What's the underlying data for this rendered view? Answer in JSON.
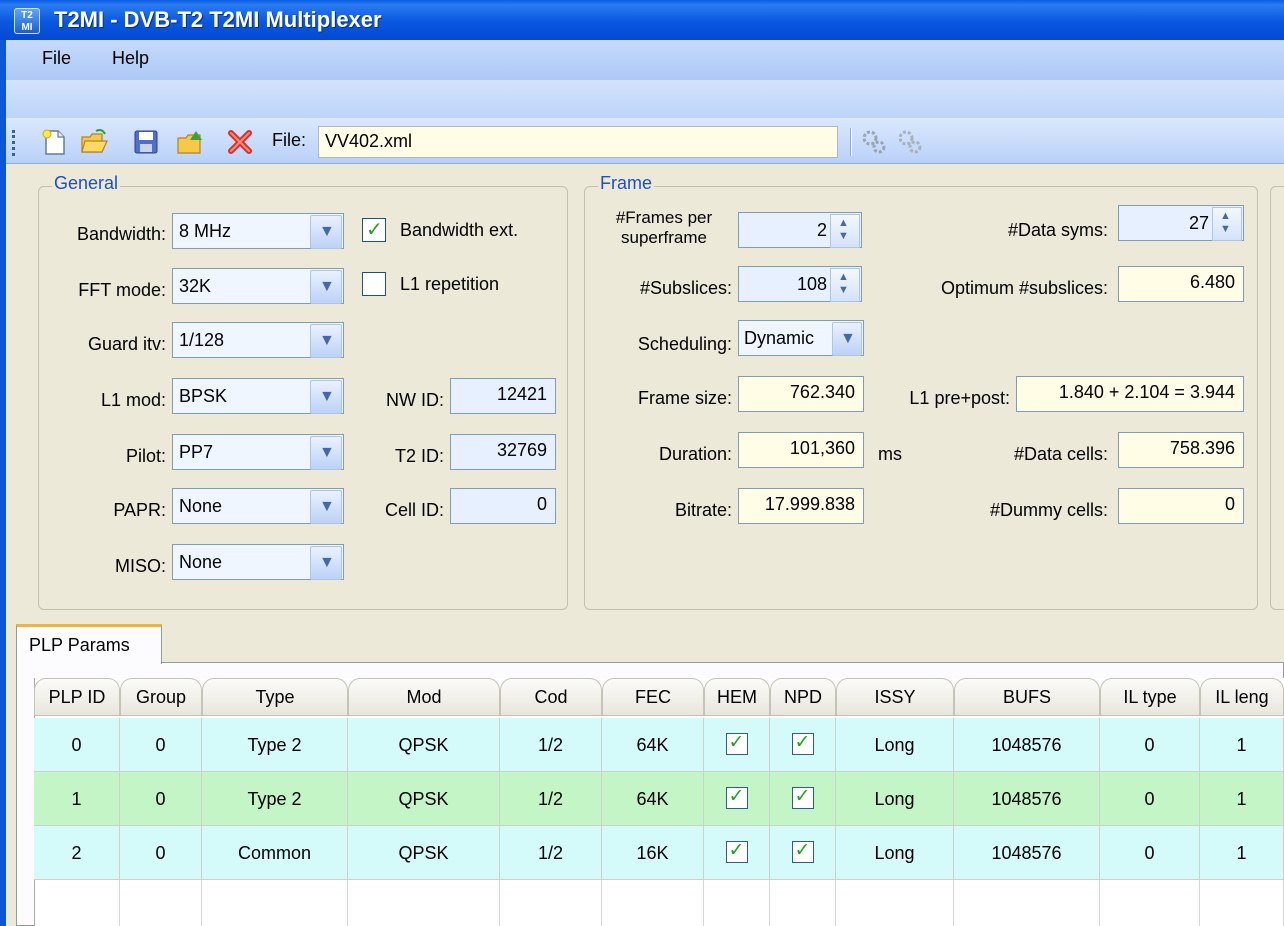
{
  "window": {
    "title": "T2MI - DVB-T2 T2MI Multiplexer",
    "icon_text": "T2\nMI"
  },
  "menu": {
    "file": "File",
    "help": "Help"
  },
  "toolbar": {
    "file_label": "File:",
    "file_value": "VV402.xml"
  },
  "general": {
    "title": "General",
    "bandwidth_label": "Bandwidth:",
    "bandwidth_value": "8 MHz",
    "bandwidth_ext_label": "Bandwidth ext.",
    "bandwidth_ext_checked": true,
    "fft_label": "FFT mode:",
    "fft_value": "32K",
    "l1rep_label": "L1 repetition",
    "l1rep_checked": false,
    "guard_label": "Guard itv:",
    "guard_value": "1/128",
    "l1mod_label": "L1 mod:",
    "l1mod_value": "BPSK",
    "pilot_label": "Pilot:",
    "pilot_value": "PP7",
    "papr_label": "PAPR:",
    "papr_value": "None",
    "miso_label": "MISO:",
    "miso_value": "None",
    "nwid_label": "NW ID:",
    "nwid_value": "12421",
    "t2id_label": "T2 ID:",
    "t2id_value": "32769",
    "cellid_label": "Cell ID:",
    "cellid_value": "0"
  },
  "frame": {
    "title": "Frame",
    "frames_label_1": "#Frames per",
    "frames_label_2": "superframe",
    "frames_value": "2",
    "subslices_label": "#Subslices:",
    "subslices_value": "108",
    "scheduling_label": "Scheduling:",
    "scheduling_value": "Dynamic",
    "framesize_label": "Frame size:",
    "framesize_value": "762.340",
    "duration_label": "Duration:",
    "duration_value": "101,360",
    "duration_unit": "ms",
    "bitrate_label": "Bitrate:",
    "bitrate_value": "17.999.838",
    "datasyms_label": "#Data syms:",
    "datasyms_value": "27",
    "optsub_label": "Optimum #subslices:",
    "optsub_value": "6.480",
    "l1pp_label": "L1 pre+post:",
    "l1pp_value": "1.840 + 2.104 = 3.944",
    "datacells_label": "#Data cells:",
    "datacells_value": "758.396",
    "dummycells_label": "#Dummy cells:",
    "dummycells_value": "0"
  },
  "tabs": {
    "plp": "PLP Params"
  },
  "grid": {
    "headers": [
      "PLP ID",
      "Group",
      "Type",
      "Mod",
      "Cod",
      "FEC",
      "HEM",
      "NPD",
      "ISSY",
      "BUFS",
      "IL type",
      "IL leng"
    ],
    "rows": [
      {
        "plp_id": "0",
        "group": "0",
        "type": "Type 2",
        "mod": "QPSK",
        "cod": "1/2",
        "fec": "64K",
        "hem": true,
        "npd": true,
        "issy": "Long",
        "bufs": "1048576",
        "il_type": "0",
        "il_len": "1"
      },
      {
        "plp_id": "1",
        "group": "0",
        "type": "Type 2",
        "mod": "QPSK",
        "cod": "1/2",
        "fec": "64K",
        "hem": true,
        "npd": true,
        "issy": "Long",
        "bufs": "1048576",
        "il_type": "0",
        "il_len": "1"
      },
      {
        "plp_id": "2",
        "group": "0",
        "type": "Common",
        "mod": "QPSK",
        "cod": "1/2",
        "fec": "16K",
        "hem": true,
        "npd": true,
        "issy": "Long",
        "bufs": "1048576",
        "il_type": "0",
        "il_len": "1"
      }
    ]
  },
  "colors": {
    "row_a": "#d4fafa",
    "row_b": "#c4f5c6",
    "title_bar": "#0857e0",
    "group_title": "#1f4fbf"
  }
}
